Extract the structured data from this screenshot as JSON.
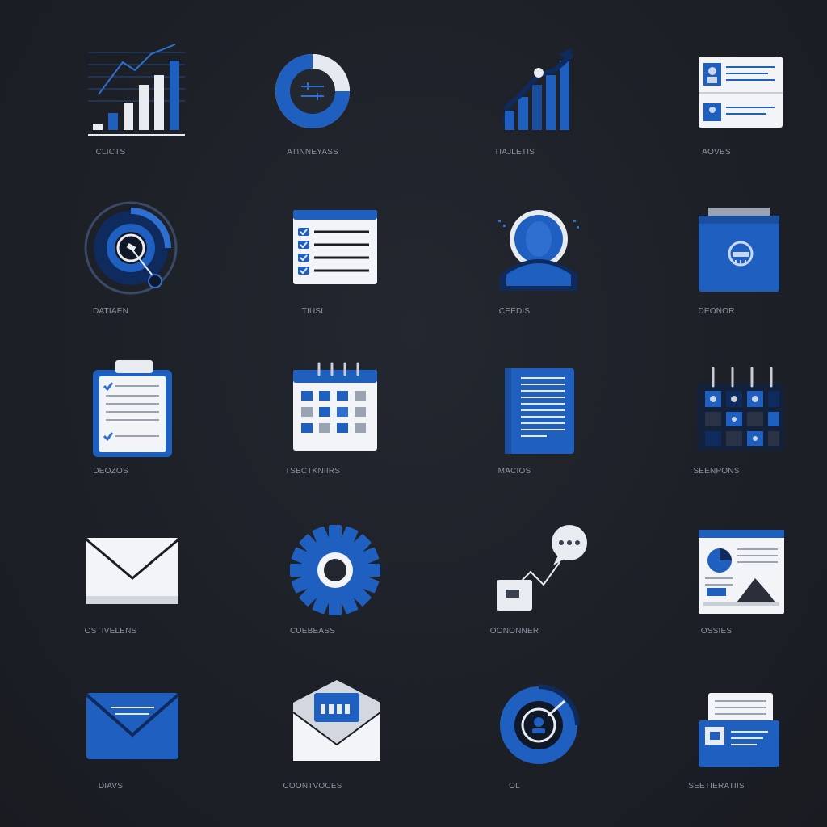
{
  "colors": {
    "background": "#1d2027",
    "accent_blue": "#1f5fbf",
    "light_blue": "#3a7fe0",
    "dark_navy": "#0f2a5c",
    "paper": "#f2f4f8",
    "label": "#8c93a0"
  },
  "icons": [
    {
      "label": "CLICTS",
      "icon": "bar-chart-icon"
    },
    {
      "label": "ATINNEYASS",
      "icon": "donut-chart-icon"
    },
    {
      "label": "TIAJLETIS",
      "icon": "growth-chart-icon"
    },
    {
      "label": "AOVES",
      "icon": "contact-cards-icon"
    },
    {
      "label": "DATIAEN",
      "icon": "target-dial-icon"
    },
    {
      "label": "TIUSI",
      "icon": "checklist-icon"
    },
    {
      "label": "CEEDIS",
      "icon": "user-profile-icon"
    },
    {
      "label": "DEONOR",
      "icon": "folder-icon"
    },
    {
      "label": "DEOZOS",
      "icon": "clipboard-icon"
    },
    {
      "label": "TSECTKNIIRS",
      "icon": "calendar-icon"
    },
    {
      "label": "MACIOS",
      "icon": "document-icon"
    },
    {
      "label": "SEENPONS",
      "icon": "dark-calendar-icon"
    },
    {
      "label": "OSTIVELENS",
      "icon": "envelope-icon"
    },
    {
      "label": "CUEBEASS",
      "icon": "gear-icon"
    },
    {
      "label": "OONONNER",
      "icon": "chat-connector-icon"
    },
    {
      "label": "OSSIES",
      "icon": "report-window-icon"
    },
    {
      "label": "DIAVS",
      "icon": "blue-envelope-icon"
    },
    {
      "label": "COONTVOCES",
      "icon": "open-mail-icon"
    },
    {
      "label": "OL",
      "icon": "badge-circle-icon"
    },
    {
      "label": "SEETIERATIIS",
      "icon": "file-folder-icon"
    }
  ]
}
